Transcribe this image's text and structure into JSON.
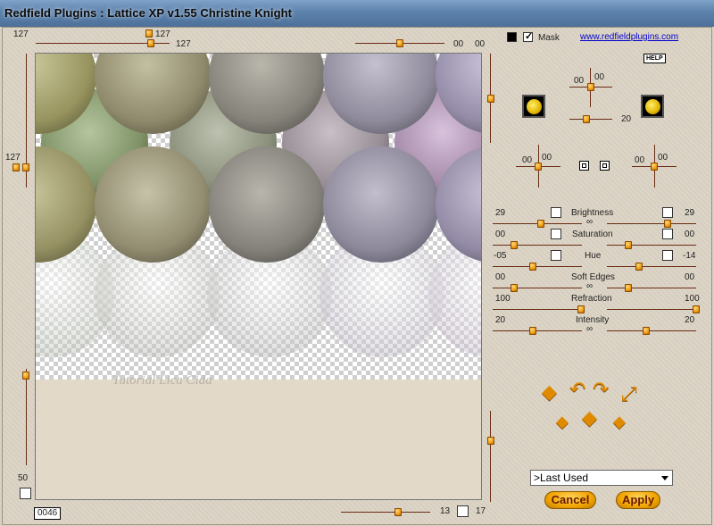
{
  "window": {
    "title": "Redfield Plugins : Lattice XP v1.55   Christine Knight"
  },
  "top": {
    "left_value": "127",
    "knob_value": "127",
    "slider_value": "127",
    "right_a": "00",
    "right_b": "00",
    "mask_label": "Mask",
    "link": "www.redfieldplugins.com",
    "help": "HELP"
  },
  "left": {
    "top_value": "127",
    "bottom_value": "50"
  },
  "preview": {
    "watermark": "Tutorial Lica Cida"
  },
  "bottom": {
    "counter": "0046",
    "value_a": "13",
    "value_b": "17"
  },
  "light": {
    "top_a": "00",
    "top_b": "00",
    "bottom_value": "20",
    "left_a": "00",
    "left_b": "00",
    "right_a": "00",
    "right_b": "00"
  },
  "params": [
    {
      "name": "Brightness",
      "left": "29",
      "right": "29"
    },
    {
      "name": "Saturation",
      "left": "00",
      "right": "00"
    },
    {
      "name": "Hue",
      "left": "-05",
      "right": "-14"
    },
    {
      "name": "Soft Edges",
      "left": "00",
      "right": "00"
    },
    {
      "name": "Refraction",
      "left": "100",
      "right": "100"
    },
    {
      "name": "Intensity",
      "left": "20",
      "right": "20"
    }
  ],
  "preset": {
    "selected": ">Last Used"
  },
  "buttons": {
    "cancel": "Cancel",
    "apply": "Apply"
  }
}
